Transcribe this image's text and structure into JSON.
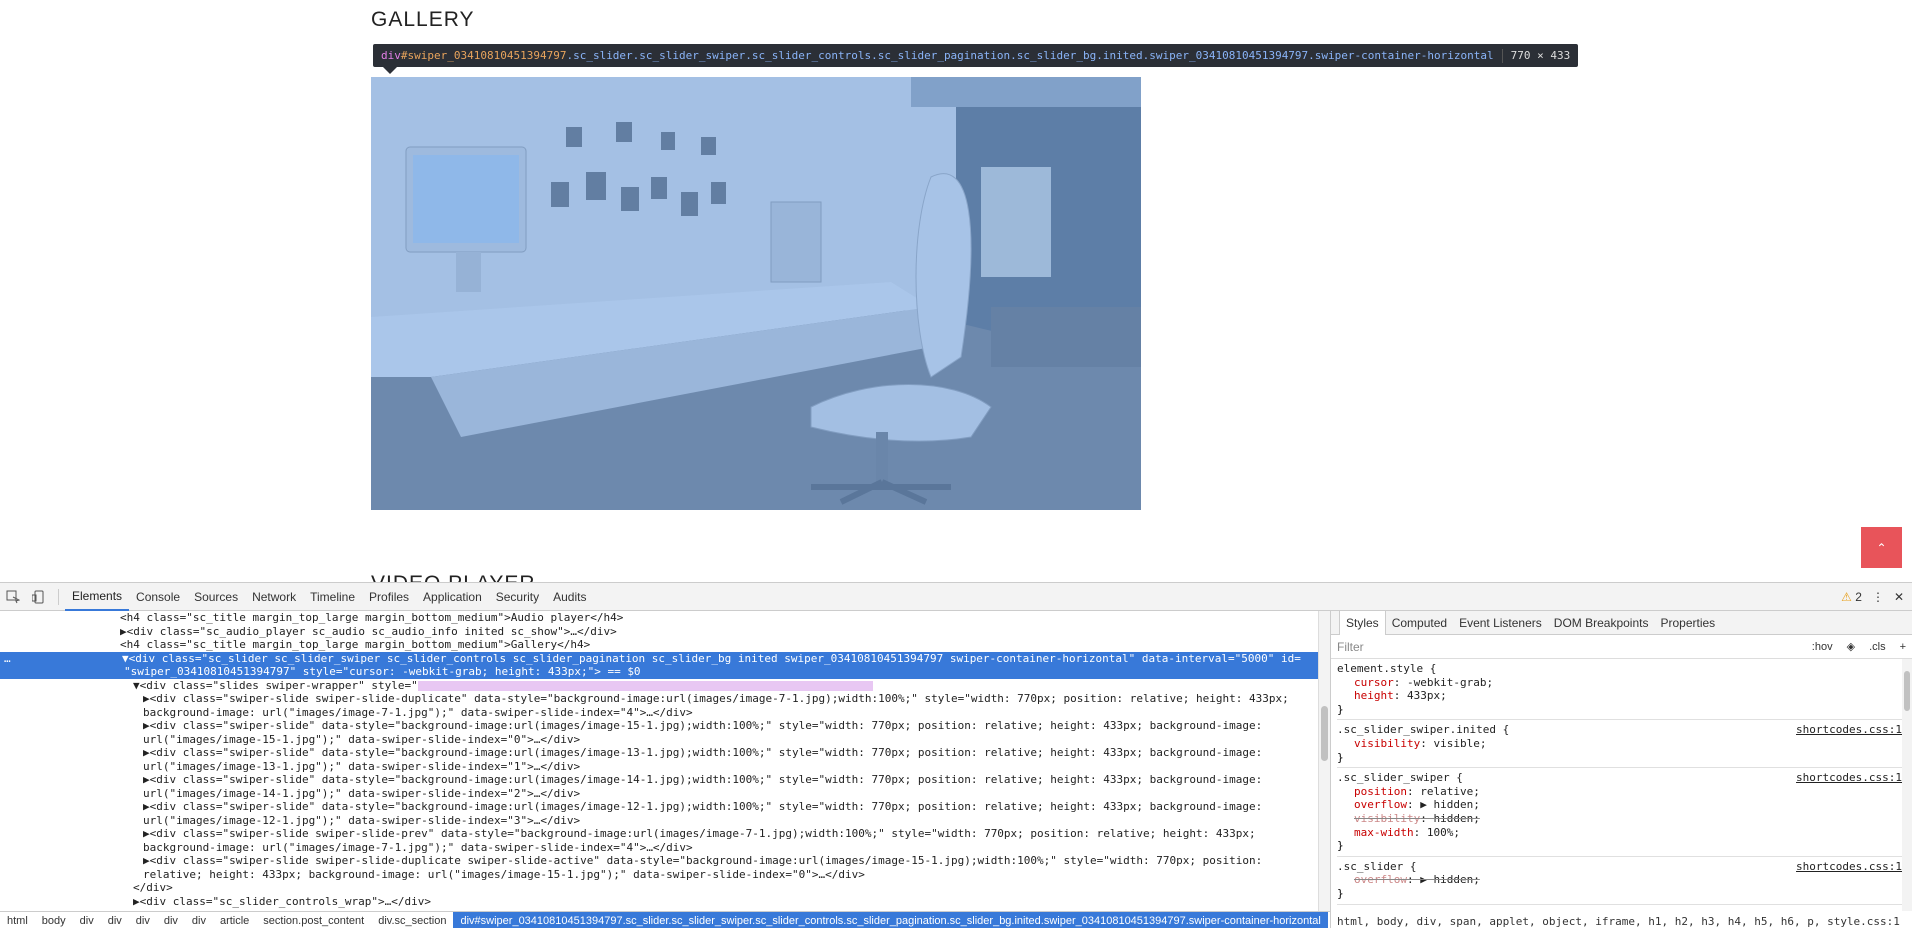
{
  "page": {
    "gallery_title": "GALLERY",
    "video_title": "VIDEO PLAYER",
    "scroll_top_icon": "chevron-up-icon"
  },
  "tooltip": {
    "tag": "div",
    "id": "#swiper_03410810451394797",
    "classes": ".sc_slider.sc_slider_swiper.sc_slider_controls.sc_slider_pagination.sc_slider_bg.inited.swiper_03410810451394797.swiper-container-horizontal",
    "size": "770 × 433"
  },
  "devtools": {
    "tabs": [
      "Elements",
      "Console",
      "Sources",
      "Network",
      "Timeline",
      "Profiles",
      "Application",
      "Security",
      "Audits"
    ],
    "active_tab": "Elements",
    "warning_count": "2",
    "lines": [
      {
        "indent": 0,
        "text": "<h4 class=\"sc_title margin_top_large margin_bottom_medium\">Audio player</h4>"
      },
      {
        "indent": 0,
        "text": "▶<div class=\"sc_audio_player sc_audio sc_audio_info inited sc_show\">…</div>"
      },
      {
        "indent": 0,
        "text": "<h4 class=\"sc_title margin_top_large margin_bottom_medium\">Gallery</h4>"
      },
      {
        "indent": 0,
        "text": "▼<div class=\"sc_slider sc_slider_swiper sc_slider_controls sc_slider_pagination sc_slider_bg inited swiper_03410810451394797 swiper-container-horizontal\" data-interval=\"5000\" id="
      },
      {
        "indent": 0,
        "text": "\"swiper_03410810451394797\" style=\"cursor: -webkit-grab; height: 433px;\"> == $0"
      },
      {
        "indent": 1,
        "text": "▼<div class=\"slides swiper-wrapper\" style=\""
      },
      {
        "indent": 2,
        "text": "▶<div class=\"swiper-slide swiper-slide-duplicate\" data-style=\"background-image:url(images/image-7-1.jpg);width:100%;\" style=\"width: 770px; position: relative; height: 433px;"
      },
      {
        "indent": 2,
        "text": "background-image: url(\"images/image-7-1.jpg\");\" data-swiper-slide-index=\"4\">…</div>"
      },
      {
        "indent": 2,
        "text": "▶<div class=\"swiper-slide\" data-style=\"background-image:url(images/image-15-1.jpg);width:100%;\" style=\"width: 770px; position: relative; height: 433px; background-image:"
      },
      {
        "indent": 2,
        "text": "url(\"images/image-15-1.jpg\");\" data-swiper-slide-index=\"0\">…</div>"
      },
      {
        "indent": 2,
        "text": "▶<div class=\"swiper-slide\" data-style=\"background-image:url(images/image-13-1.jpg);width:100%;\" style=\"width: 770px; position: relative; height: 433px; background-image:"
      },
      {
        "indent": 2,
        "text": "url(\"images/image-13-1.jpg\");\" data-swiper-slide-index=\"1\">…</div>"
      },
      {
        "indent": 2,
        "text": "▶<div class=\"swiper-slide\" data-style=\"background-image:url(images/image-14-1.jpg);width:100%;\" style=\"width: 770px; position: relative; height: 433px; background-image:"
      },
      {
        "indent": 2,
        "text": "url(\"images/image-14-1.jpg\");\" data-swiper-slide-index=\"2\">…</div>"
      },
      {
        "indent": 2,
        "text": "▶<div class=\"swiper-slide\" data-style=\"background-image:url(images/image-12-1.jpg);width:100%;\" style=\"width: 770px; position: relative; height: 433px; background-image:"
      },
      {
        "indent": 2,
        "text": "url(\"images/image-12-1.jpg\");\" data-swiper-slide-index=\"3\">…</div>"
      },
      {
        "indent": 2,
        "text": "▶<div class=\"swiper-slide swiper-slide-prev\" data-style=\"background-image:url(images/image-7-1.jpg);width:100%;\" style=\"width: 770px; position: relative; height: 433px;"
      },
      {
        "indent": 2,
        "text": "background-image: url(\"images/image-7-1.jpg\");\" data-swiper-slide-index=\"4\">…</div>"
      },
      {
        "indent": 2,
        "text": "▶<div class=\"swiper-slide swiper-slide-duplicate swiper-slide-active\" data-style=\"background-image:url(images/image-15-1.jpg);width:100%;\" style=\"width: 770px; position:"
      },
      {
        "indent": 2,
        "text": "relative; height: 433px; background-image: url(\"images/image-15-1.jpg\");\" data-swiper-slide-index=\"0\">…</div>"
      },
      {
        "indent": 1,
        "text": "</div>"
      },
      {
        "indent": 1,
        "text": "▶<div class=\"sc_slider_controls_wrap\">…</div>"
      }
    ],
    "breadcrumbs": [
      "html",
      "body",
      "div",
      "div",
      "div",
      "div",
      "div",
      "article",
      "section.post_content",
      "div.sc_section",
      "div#swiper_03410810451394797.sc_slider.sc_slider_swiper.sc_slider_controls.sc_slider_pagination.sc_slider_bg.inited.swiper_03410810451394797.swiper-container-horizontal"
    ],
    "styles": {
      "tabs": [
        "Styles",
        "Computed",
        "Event Listeners",
        "DOM Breakpoints",
        "Properties"
      ],
      "filter_placeholder": "Filter",
      "hov": ":hov",
      "cls": ".cls",
      "add": "+",
      "rules": [
        {
          "selector": "element.style {",
          "source": "",
          "props": [
            {
              "n": "cursor",
              "v": "-webkit-grab;",
              "s": false
            },
            {
              "n": "height",
              "v": "433px;",
              "s": false
            }
          ]
        },
        {
          "selector": ".sc_slider_swiper.inited {",
          "source": "shortcodes.css:1",
          "props": [
            {
              "n": "visibility",
              "v": "visible;",
              "s": false
            }
          ]
        },
        {
          "selector": ".sc_slider_swiper {",
          "source": "shortcodes.css:1",
          "props": [
            {
              "n": "position",
              "v": "relative;",
              "s": false
            },
            {
              "n": "overflow",
              "v": "▶ hidden;",
              "s": false
            },
            {
              "n": "visibility",
              "v": "hidden;",
              "s": true
            },
            {
              "n": "max-width",
              "v": "100%;",
              "s": false
            }
          ]
        },
        {
          "selector": ".sc_slider {",
          "source": "shortcodes.css:1",
          "props": [
            {
              "n": "overflow",
              "v": "▶ hidden;",
              "s": true
            }
          ]
        }
      ],
      "inherited_tags": "html, body, div, span, applet, object, iframe, h1, h2, h3, h4, h5, h6, p, style.css:1"
    }
  },
  "colors": {
    "selection": "#3879d9",
    "scroll_top_bg": "#e8545a",
    "overlay": "#6ea0e1"
  }
}
